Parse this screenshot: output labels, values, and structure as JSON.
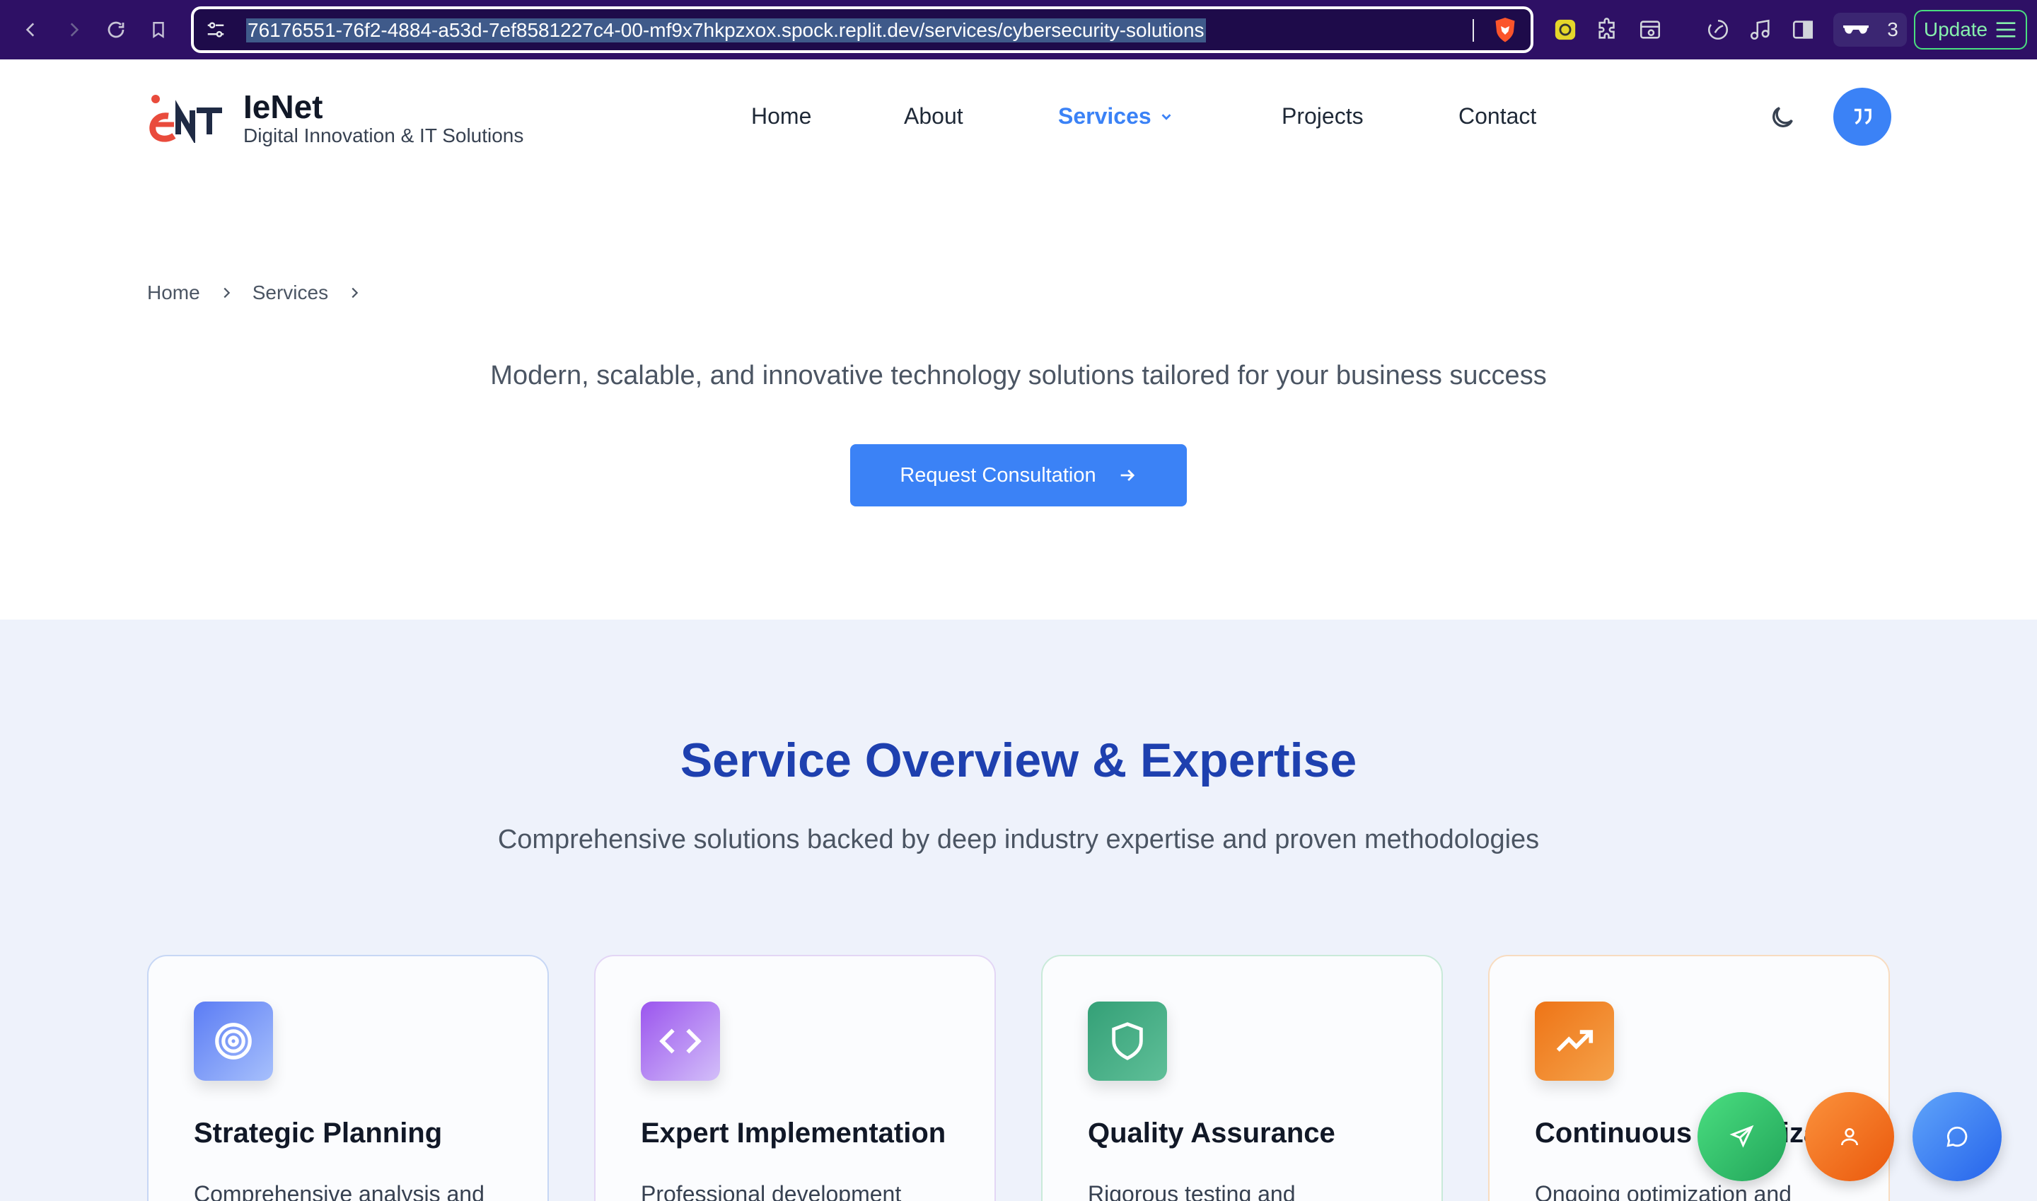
{
  "browser": {
    "url": "76176551-76f2-4884-a53d-7ef8581227c4-00-mf9x7hkpzxox.spock.replit.dev/services/cybersecurity-solutions",
    "profile_count": "3",
    "update_label": "Update"
  },
  "header": {
    "brand_name": "IeNet",
    "brand_tagline": "Digital Innovation & IT Solutions",
    "nav": [
      "Home",
      "About",
      "Services",
      "Projects",
      "Contact"
    ]
  },
  "breadcrumb": [
    "Home",
    "Services"
  ],
  "hero": {
    "subtitle": "Modern, scalable, and innovative technology solutions tailored for your business success",
    "cta_label": "Request Consultation"
  },
  "overview": {
    "title": "Service Overview & Expertise",
    "subtitle": "Comprehensive solutions backed by deep industry expertise and proven methodologies",
    "cards": [
      {
        "title": "Strategic Planning",
        "desc": "Comprehensive analysis and",
        "icon": "target-icon",
        "color_from": "#6b8cf7",
        "color_to": "#93b2fb",
        "border": "#c7d7f5"
      },
      {
        "title": "Expert Implementation",
        "desc": "Professional development",
        "icon": "code-icon",
        "color_from": "#9f5cf0",
        "color_to": "#c4a5f8",
        "border": "#e3d6f5"
      },
      {
        "title": "Quality Assurance",
        "desc": "Rigorous testing and",
        "icon": "shield-icon",
        "color_from": "#3aa57d",
        "color_to": "#5bbf96",
        "border": "#c9ead9"
      },
      {
        "title": "Continuous Optimization",
        "desc": "Ongoing optimization and",
        "icon": "trending-up-icon",
        "color_from": "#f07b1f",
        "color_to": "#f6a84e",
        "border": "#f8dcc0"
      }
    ]
  },
  "colors": {
    "accent": "#3b82f6",
    "heading_blue": "#1e40af",
    "fab_send": "#4ade80",
    "fab_user": "#f97316",
    "fab_chat": "#3b82f6"
  }
}
